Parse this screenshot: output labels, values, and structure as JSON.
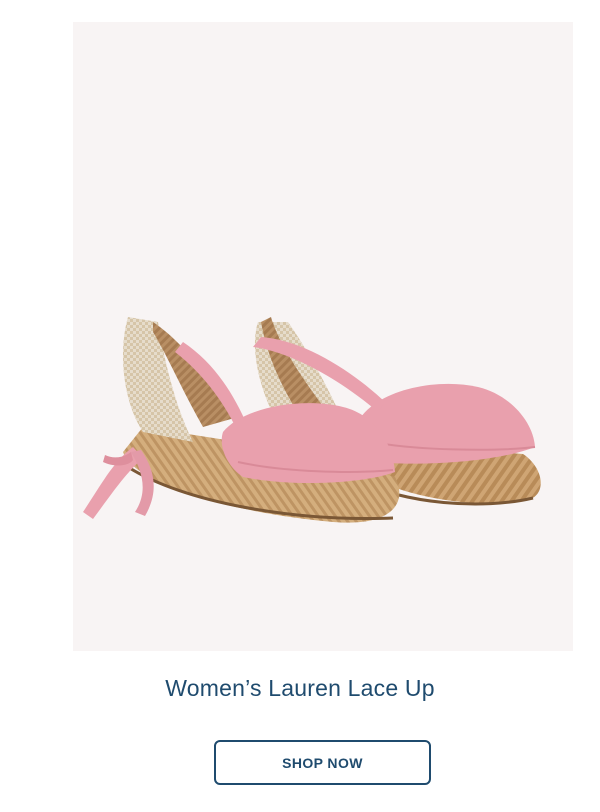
{
  "product": {
    "title": "Women’s Lauren Lace Up",
    "image_icon": "pink-espadrille-sandal-image",
    "image_background": "#f8f4f4",
    "shoe_color": "#e9a0ad",
    "jute_color": "#c9a36f"
  },
  "cta": {
    "label": "SHOP NOW",
    "color": "#1f4b6e"
  }
}
